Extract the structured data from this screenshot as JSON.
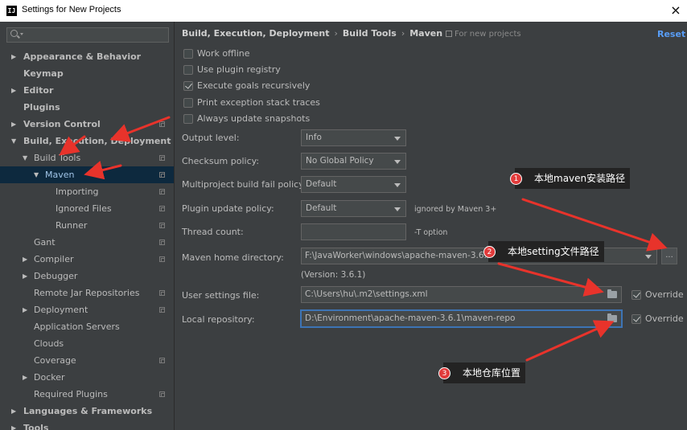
{
  "window": {
    "title": "Settings for New Projects",
    "app_icon": "IJ"
  },
  "search": {
    "placeholder": ""
  },
  "sidebar": {
    "items": [
      {
        "label": "Appearance & Behavior",
        "arrow": "▶",
        "bold": true
      },
      {
        "label": "Keymap",
        "bold": true
      },
      {
        "label": "Editor",
        "arrow": "▶",
        "bold": true
      },
      {
        "label": "Plugins",
        "bold": true
      },
      {
        "label": "Version Control",
        "arrow": "▶",
        "bold": true,
        "copy": true
      },
      {
        "label": "Build, Execution, Deployment",
        "arrow": "▼",
        "bold": true
      },
      {
        "label": "Build Tools",
        "arrow": "▼",
        "copy": true
      },
      {
        "label": "Maven",
        "arrow": "▼",
        "copy": true,
        "selected": true
      },
      {
        "label": "Importing",
        "copy": true
      },
      {
        "label": "Ignored Files",
        "copy": true
      },
      {
        "label": "Runner",
        "copy": true
      },
      {
        "label": "Gant",
        "copy": true
      },
      {
        "label": "Compiler",
        "arrow": "▶",
        "copy": true
      },
      {
        "label": "Debugger",
        "arrow": "▶"
      },
      {
        "label": "Remote Jar Repositories",
        "copy": true
      },
      {
        "label": "Deployment",
        "arrow": "▶",
        "copy": true
      },
      {
        "label": "Application Servers"
      },
      {
        "label": "Clouds"
      },
      {
        "label": "Coverage",
        "copy": true
      },
      {
        "label": "Docker",
        "arrow": "▶"
      },
      {
        "label": "Required Plugins",
        "copy": true
      },
      {
        "label": "Languages & Frameworks",
        "arrow": "▶",
        "bold": true
      },
      {
        "label": "Tools",
        "arrow": "▶",
        "bold": true
      }
    ]
  },
  "breadcrumb": {
    "part1": "Build, Execution, Deployment",
    "part2": "Build Tools",
    "part3": "Maven",
    "separator": "›"
  },
  "for_new_projects": "For new projects",
  "reset_label": "Reset",
  "checkboxes": [
    {
      "label": "Work offline",
      "checked": false
    },
    {
      "label": "Use plugin registry",
      "checked": false
    },
    {
      "label": "Execute goals recursively",
      "checked": true
    },
    {
      "label": "Print exception stack traces",
      "checked": false
    },
    {
      "label": "Always update snapshots",
      "checked": false
    }
  ],
  "form": {
    "output_level": {
      "label": "Output level:",
      "value": "Info"
    },
    "checksum_policy": {
      "label": "Checksum policy:",
      "value": "No Global Policy"
    },
    "multiproject_fail_policy": {
      "label": "Multiproject build fail policy:",
      "value": "Default"
    },
    "plugin_update_policy": {
      "label": "Plugin update policy:",
      "value": "Default",
      "hint": "ignored by Maven 3+"
    },
    "thread_count": {
      "label": "Thread count:",
      "value": "",
      "hint": "-T option"
    },
    "maven_home": {
      "label": "Maven home directory:",
      "value": "F:\\JavaWorker\\windows\\apache-maven-3.6.1",
      "browse_label": "..."
    },
    "version": "(Version: 3.6.1)",
    "user_settings": {
      "label": "User settings file:",
      "value": "C:\\Users\\hu\\.m2\\settings.xml",
      "override_label": "Override",
      "override_checked": true
    },
    "local_repo": {
      "label": "Local repository:",
      "value": "D:\\Environment\\apache-maven-3.6.1\\maven-repo",
      "override_label": "Override",
      "override_checked": true
    }
  },
  "annotations": [
    {
      "num": "1",
      "text": "本地maven安装路径"
    },
    {
      "num": "2",
      "text": "本地setting文件路径"
    },
    {
      "num": "3",
      "text": "本地仓库位置"
    }
  ],
  "colors": {
    "background": "#3c3f41",
    "selection": "#0d293e",
    "accent": "#589df6",
    "arrow": "#e8332b",
    "focus": "#3d74b5"
  }
}
